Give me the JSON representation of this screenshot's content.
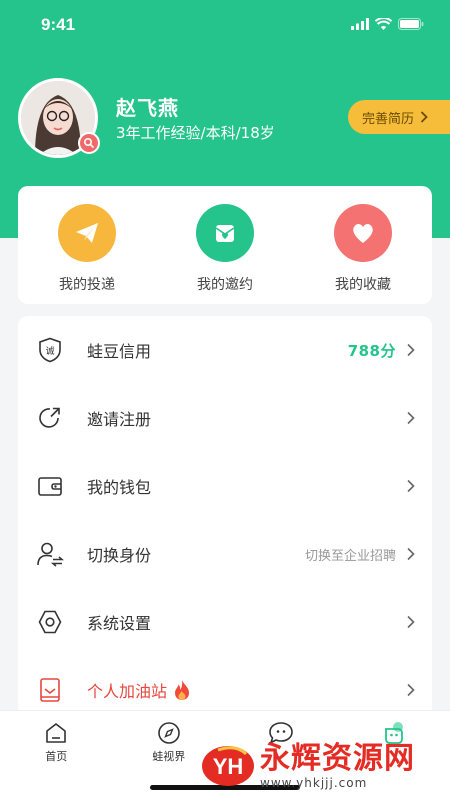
{
  "status_bar": {
    "time": "9:41"
  },
  "profile": {
    "name": "赵飞燕",
    "info": "3年工作经验/本科/18岁",
    "resume_button": "完善简历"
  },
  "quick_actions": [
    {
      "label": "我的投递",
      "icon": "paper-plane-icon",
      "color": "#f6b73c"
    },
    {
      "label": "我的邀约",
      "icon": "invitation-icon",
      "color": "#25c48c"
    },
    {
      "label": "我的收藏",
      "icon": "heart-icon",
      "color": "#f47272"
    }
  ],
  "menu": [
    {
      "label": "蛙豆信用",
      "value": "788分",
      "icon": "credit-shield-icon"
    },
    {
      "label": "邀请注册",
      "value": "",
      "icon": "share-icon"
    },
    {
      "label": "我的钱包",
      "value": "",
      "icon": "wallet-icon"
    },
    {
      "label": "切换身份",
      "value": "切换至企业招聘",
      "icon": "switch-user-icon"
    },
    {
      "label": "系统设置",
      "value": "",
      "icon": "settings-icon"
    },
    {
      "label": "个人加油站",
      "value": "",
      "icon": "book-icon"
    }
  ],
  "menu_icon_glyph": {
    "credit": "诚"
  },
  "tabs": [
    {
      "label": "首页",
      "icon": "home-icon"
    },
    {
      "label": "蛙视界",
      "icon": "compass-icon"
    },
    {
      "label": "",
      "icon": "message-icon"
    },
    {
      "label": "",
      "icon": "profile-icon"
    }
  ],
  "watermark": {
    "logo": "YH",
    "text": "永辉资源网",
    "url": "www.yhkjjj.com"
  },
  "colors": {
    "brand": "#25c48c",
    "accent": "#f6bd3a",
    "danger": "#e8463f"
  }
}
